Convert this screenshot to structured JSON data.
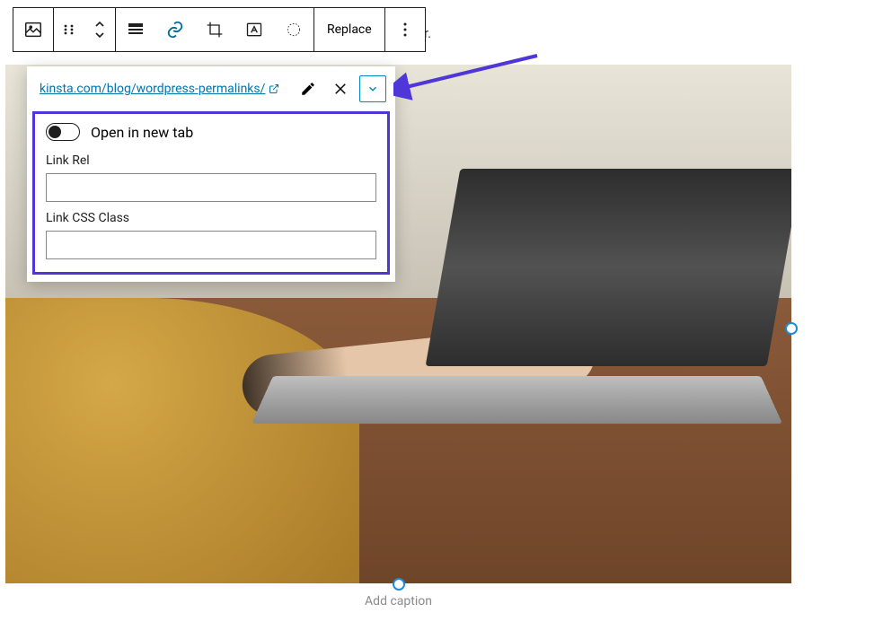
{
  "toolbar": {
    "replace_label": "Replace"
  },
  "straytext": "r.",
  "popover": {
    "url": "kinsta.com/blog/wordpress-permalinks/",
    "open_new_tab_label": "Open in new tab",
    "link_rel_label": "Link Rel",
    "link_rel_value": "",
    "link_css_label": "Link CSS Class",
    "link_css_value": ""
  },
  "image": {
    "caption_placeholder": "Add caption"
  }
}
